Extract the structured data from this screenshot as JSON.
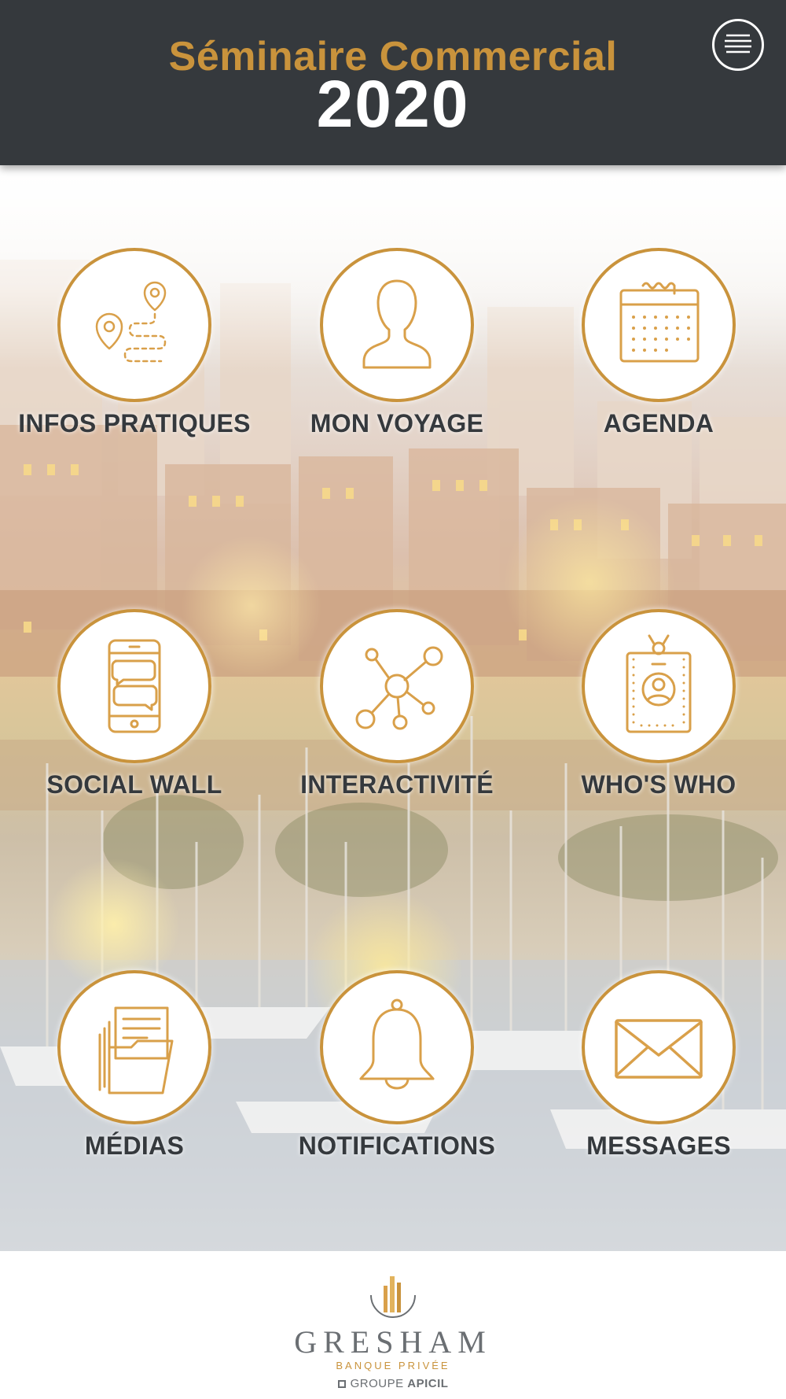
{
  "header": {
    "title_line1": "Séminaire Commercial",
    "title_line2": "2020",
    "menu_icon": "hamburger-menu-icon"
  },
  "tiles": [
    {
      "label": "INFOS PRATIQUES",
      "icon": "map-route-pins-icon"
    },
    {
      "label": "MON VOYAGE",
      "icon": "person-silhouette-icon"
    },
    {
      "label": "AGENDA",
      "icon": "calendar-icon"
    },
    {
      "label": "SOCIAL WALL",
      "icon": "phone-chat-icon"
    },
    {
      "label": "INTERACTIVITÉ",
      "icon": "network-nodes-icon"
    },
    {
      "label": "WHO'S WHO",
      "icon": "id-badge-icon"
    },
    {
      "label": "MÉDIAS",
      "icon": "folder-documents-icon"
    },
    {
      "label": "NOTIFICATIONS",
      "icon": "bell-icon"
    },
    {
      "label": "MESSAGES",
      "icon": "envelope-icon"
    }
  ],
  "footer": {
    "brand_name": "GRESHAM",
    "brand_subtitle": "BANQUE PRIVÉE",
    "group_prefix": "GROUPE",
    "group_name": "APICIL"
  },
  "colors": {
    "header_bg": "#35393d",
    "accent_gold": "#c9933c",
    "label_text": "#35393d"
  }
}
